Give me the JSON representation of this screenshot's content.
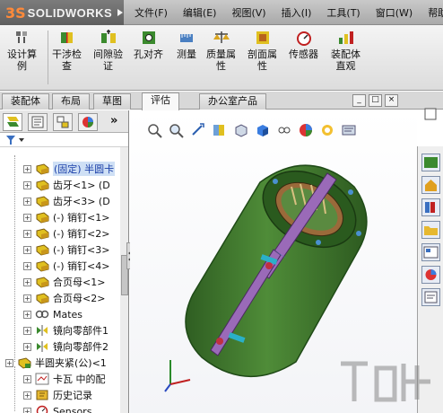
{
  "app": {
    "logo_ds": "3S",
    "logo_text": "SOLIDWORKS"
  },
  "menu": [
    "文件(F)",
    "编辑(E)",
    "视图(V)",
    "插入(I)",
    "工具(T)",
    "窗口(W)",
    "帮助"
  ],
  "commands": [
    {
      "label": "设计算\n例",
      "icon": "design-study-icon"
    },
    {
      "label": "干涉检\n查",
      "icon": "interference-check-icon"
    },
    {
      "label": "间隙验\n证",
      "icon": "clearance-verification-icon"
    },
    {
      "label": "孔对齐",
      "icon": "hole-alignment-icon"
    },
    {
      "label": "测量",
      "icon": "measure-icon"
    },
    {
      "label": "质量属\n性",
      "icon": "mass-properties-icon"
    },
    {
      "label": "剖面属\n性",
      "icon": "section-properties-icon"
    },
    {
      "label": "传感器",
      "icon": "sensor-icon"
    },
    {
      "label": "装配体\n直观",
      "icon": "assembly-visualization-icon"
    }
  ],
  "tabs": [
    "装配体",
    "布局",
    "草图",
    "评估",
    "办公室产品"
  ],
  "active_tab": "评估",
  "window_buttons": [
    "_",
    "□",
    "×"
  ],
  "feature_tree": {
    "overflow": "»",
    "items": [
      {
        "label": "(固定) 半圆卡",
        "selected": true
      },
      {
        "label": "齿牙<1> (D"
      },
      {
        "label": "齿牙<3> (D"
      },
      {
        "label": "(-) 销钉<1>"
      },
      {
        "label": "(-) 销钉<2>"
      },
      {
        "label": "(-) 销钉<3>"
      },
      {
        "label": "(-) 销钉<4>"
      },
      {
        "label": "合页母<1>"
      },
      {
        "label": "合页母<2>"
      },
      {
        "label": "Mates"
      },
      {
        "label": "镜向零部件1"
      },
      {
        "label": "镜向零部件2"
      },
      {
        "label": "半圆夹紧(公)<1"
      },
      {
        "label": "卡瓦 中的配"
      },
      {
        "label": "历史记录"
      },
      {
        "label": "Sensors"
      }
    ]
  },
  "colors": {
    "model_green": "#3f7a2e",
    "model_dark": "#1f4a17",
    "slot_purple": "#9a6ab8",
    "selection": "#cfe0f5",
    "logo_orange": "#ff8a3a"
  }
}
